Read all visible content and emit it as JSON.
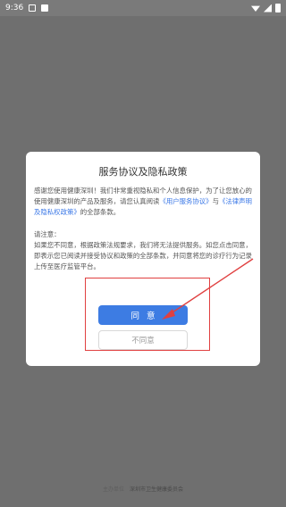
{
  "status_bar": {
    "time": "9:36",
    "left_icons": [
      "image-notification-icon",
      "app-notification-icon"
    ],
    "right_icons": [
      "wifi-icon",
      "signal-icon",
      "battery-icon"
    ]
  },
  "dialog": {
    "title": "服务协议及隐私政策",
    "para1_text1": "感谢您使用健康深圳！我们非常重视隐私和个人信息保护，为了让您放心的使用健康深圳的产品及服务，请您认真阅读",
    "link_user_agreement": "《用户服务协议》",
    "para1_and": "与",
    "link_privacy": "《法律声明及隐私权政策》",
    "para1_text2": "的全部条款。",
    "note_label": "请注意：",
    "para2": "如果您不同意，根据政策法规要求，我们将无法提供服务。如您点击同意，即表示您已阅读并接受协议和政策的全部条款，并同意将您的诊疗行为记录上传至医疗监管平台。",
    "agree_label": "同意",
    "disagree_label": "不同意"
  },
  "footer": {
    "label": "主办单位",
    "org": "深圳市卫生健康委员会"
  },
  "colors": {
    "overlay_background": "#6f6f6f",
    "primary_button": "#3d7ce3",
    "link": "#3b78e7",
    "annotation": "#e04040"
  }
}
